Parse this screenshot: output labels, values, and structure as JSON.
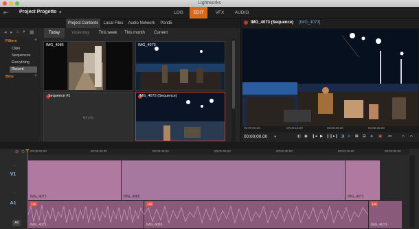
{
  "window": {
    "title": "Lightworks"
  },
  "header": {
    "project_name": "Project Progetto",
    "tabs": [
      "LOG",
      "EDIT",
      "VFX",
      "AUDIO"
    ],
    "active_tab": "EDIT"
  },
  "browser": {
    "tabs": [
      "Project Contents",
      "Local Files",
      "Audio Network",
      "Pond5"
    ],
    "time_filters": [
      "Today",
      "Yesterday",
      "This week",
      "This month",
      "Current"
    ],
    "filters_heading": "Filters",
    "filter_items": [
      "Clips",
      "Sequences",
      "Everything",
      "Recent"
    ],
    "bins_heading": "Bins",
    "clips": [
      {
        "label": "IMG_4086"
      },
      {
        "label": "IMG_4073"
      },
      {
        "label": "Sequence #1",
        "placeholder": "Empty"
      },
      {
        "label": "IMG_4073 (Sequence)"
      }
    ]
  },
  "viewer": {
    "clip_name": "IMG_4073 (Sequence)",
    "source_name": "[IMG_4073]",
    "ruler_ticks": [
      "00:00:00.00",
      "00:00:10.00",
      "00:00:20.00",
      "00:00:30.00"
    ],
    "timecode": "00:00:00.00"
  },
  "timeline": {
    "ruler_ticks": [
      "00:00:00.00",
      "00:00:20.00",
      "00:00:40.00",
      "00:01:00.00",
      "00:01:20.00",
      "00:01:40.00",
      "00:02:00.00"
    ],
    "video_track": "V1",
    "audio_track": "A1",
    "video_clips": [
      "IMG_4073",
      "IMG_4086",
      "IMG_4073"
    ],
    "audio_clips": [
      "IMG_4073",
      "IMG_4086",
      "IMG_4073"
    ],
    "all_button": "All",
    "badge": "100"
  }
}
